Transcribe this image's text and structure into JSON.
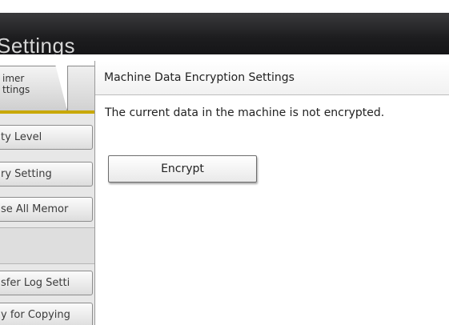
{
  "header": {
    "title": "Settings"
  },
  "tabs": [
    {
      "label_line1": "imer",
      "label_line2": "ttings"
    }
  ],
  "sidebar": {
    "items": [
      {
        "label": "ty Level"
      },
      {
        "label": "ry Setting"
      },
      {
        "label": "se All Memor"
      },
      {
        "label": "sfer Log Setti"
      },
      {
        "label": "y for Copying"
      }
    ]
  },
  "dialog": {
    "title": "Machine Data Encryption Settings",
    "message": "The current data in the machine is not encrypted.",
    "encrypt_button": "Encrypt"
  },
  "colors": {
    "header_bg": "#1d1d1f",
    "tab_underline": "#c8a800",
    "button_border": "#6d6d6d"
  }
}
